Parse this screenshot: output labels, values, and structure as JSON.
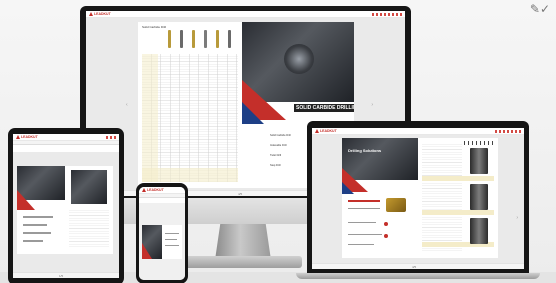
{
  "monitor": {
    "app": {
      "logo": "LEADKUT"
    },
    "right_page": {
      "heading": "SOLID CARBIDE DRILLING",
      "items": [
        "Solid Carbide Drill",
        "Indexable Drill",
        "Twist Drill",
        "Step Drill"
      ]
    },
    "left_page": {
      "title": "Solid Carbide Drill"
    },
    "page_indicator": "4/5",
    "brand_colors": {
      "accent": "#c42f2a",
      "secondary": "#1e3f86"
    }
  },
  "laptop": {
    "app": {
      "logo": "LEADKUT"
    },
    "left_page": {
      "heading": "Drilling Solutions"
    },
    "page_indicator": "4/5"
  },
  "tablet": {
    "app": {
      "logo": "LEADKUT"
    },
    "page_indicator": "1/5"
  },
  "phone": {
    "app": {
      "logo": "LEADKUT"
    }
  },
  "corner": {
    "icon": "pencil-icon"
  }
}
